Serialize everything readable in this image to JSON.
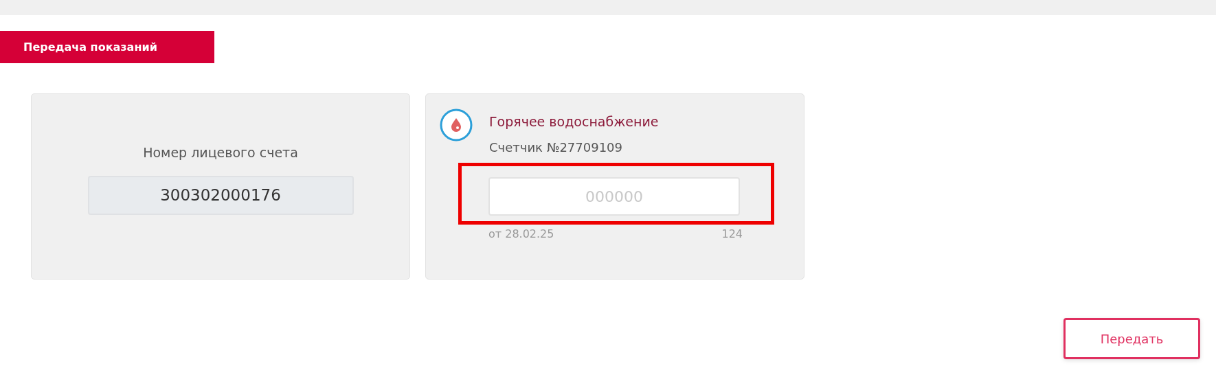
{
  "header": {
    "title": "Передача показаний"
  },
  "account": {
    "label": "Номер лицевого счета",
    "value": "300302000176"
  },
  "meter": {
    "service": "Горячее водоснабжение",
    "number": "Счетчик №27709109",
    "placeholder": "000000",
    "highlighted": true,
    "date": "от 28.02.25",
    "previous": "124"
  },
  "buttons": [
    {
      "label": "Передать"
    }
  ]
}
